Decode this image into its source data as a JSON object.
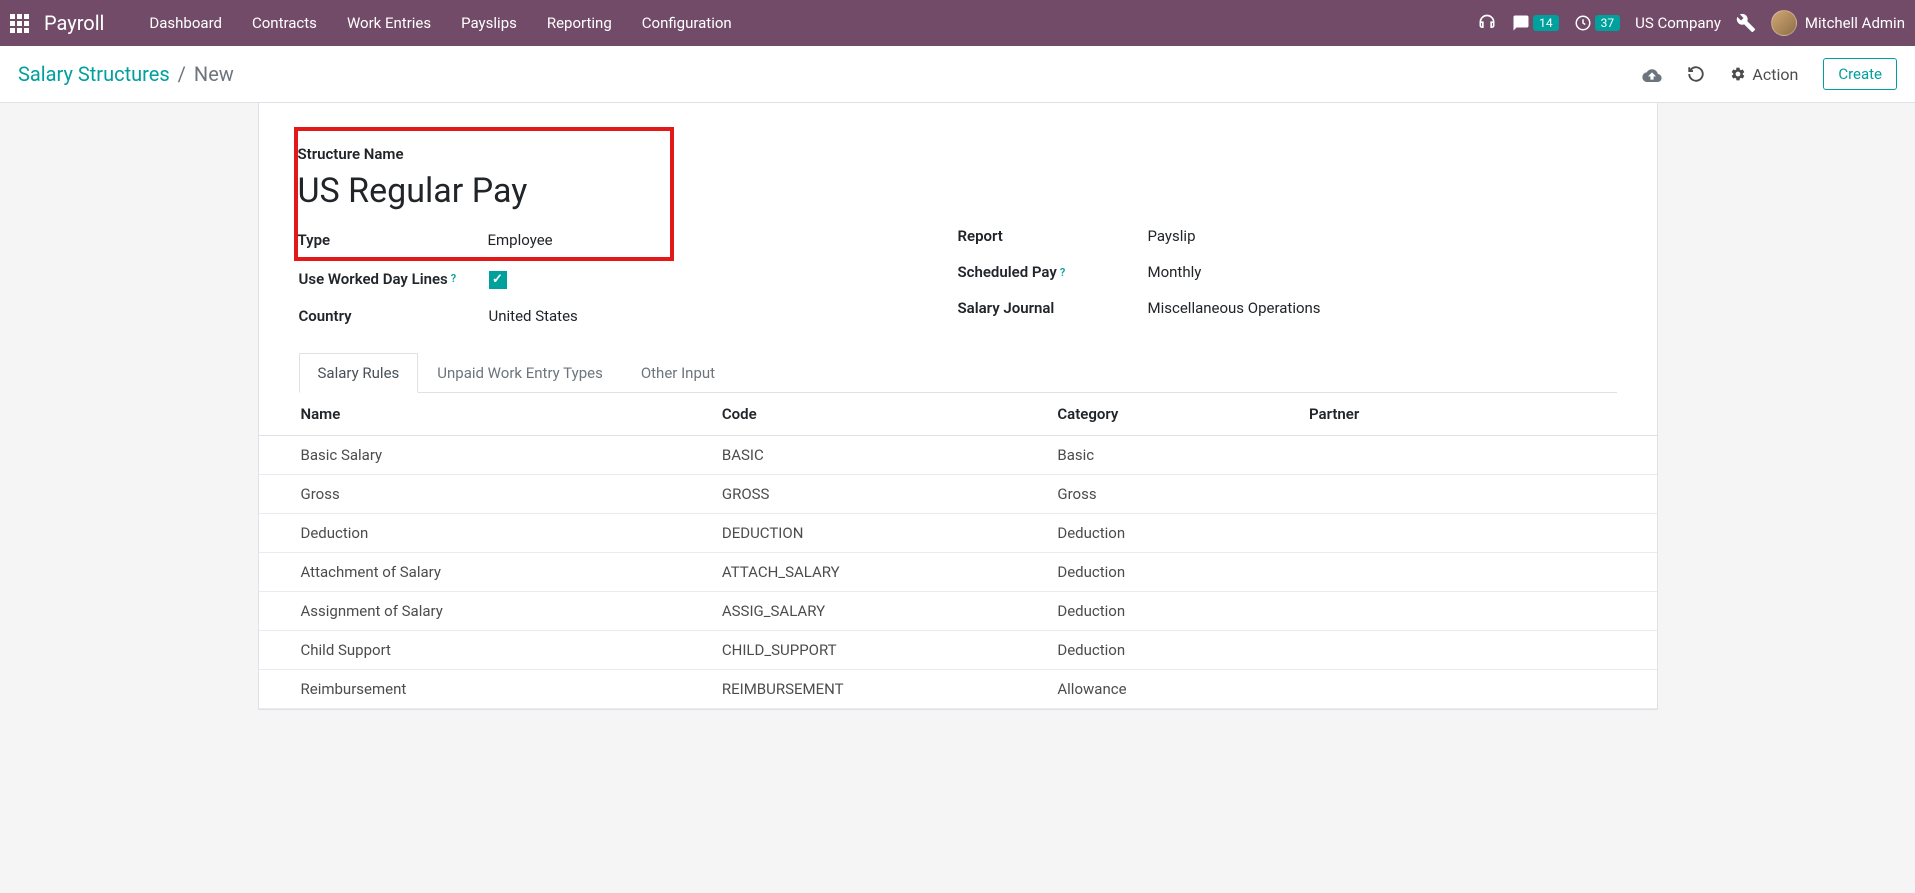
{
  "navbar": {
    "app_title": "Payroll",
    "menu": [
      "Dashboard",
      "Contracts",
      "Work Entries",
      "Payslips",
      "Reporting",
      "Configuration"
    ],
    "messages_count": "14",
    "activities_count": "37",
    "company": "US Company",
    "user": "Mitchell Admin"
  },
  "breadcrumb": {
    "parent": "Salary Structures",
    "current": "New"
  },
  "controls": {
    "action_label": "Action",
    "create_label": "Create"
  },
  "form": {
    "structure_name_label": "Structure Name",
    "structure_name_value": "US Regular Pay",
    "type_label": "Type",
    "type_value": "Employee",
    "use_worked_day_lines_label": "Use Worked Day Lines",
    "country_label": "Country",
    "country_value": "United States",
    "report_label": "Report",
    "report_value": "Payslip",
    "scheduled_pay_label": "Scheduled Pay",
    "scheduled_pay_value": "Monthly",
    "salary_journal_label": "Salary Journal",
    "salary_journal_value": "Miscellaneous Operations"
  },
  "tabs": [
    "Salary Rules",
    "Unpaid Work Entry Types",
    "Other Input"
  ],
  "table": {
    "headers": {
      "name": "Name",
      "code": "Code",
      "category": "Category",
      "partner": "Partner"
    },
    "rows": [
      {
        "name": "Basic Salary",
        "code": "BASIC",
        "category": "Basic",
        "partner": ""
      },
      {
        "name": "Gross",
        "code": "GROSS",
        "category": "Gross",
        "partner": ""
      },
      {
        "name": "Deduction",
        "code": "DEDUCTION",
        "category": "Deduction",
        "partner": ""
      },
      {
        "name": "Attachment of Salary",
        "code": "ATTACH_SALARY",
        "category": "Deduction",
        "partner": ""
      },
      {
        "name": "Assignment of Salary",
        "code": "ASSIG_SALARY",
        "category": "Deduction",
        "partner": ""
      },
      {
        "name": "Child Support",
        "code": "CHILD_SUPPORT",
        "category": "Deduction",
        "partner": ""
      },
      {
        "name": "Reimbursement",
        "code": "REIMBURSEMENT",
        "category": "Allowance",
        "partner": ""
      }
    ]
  }
}
